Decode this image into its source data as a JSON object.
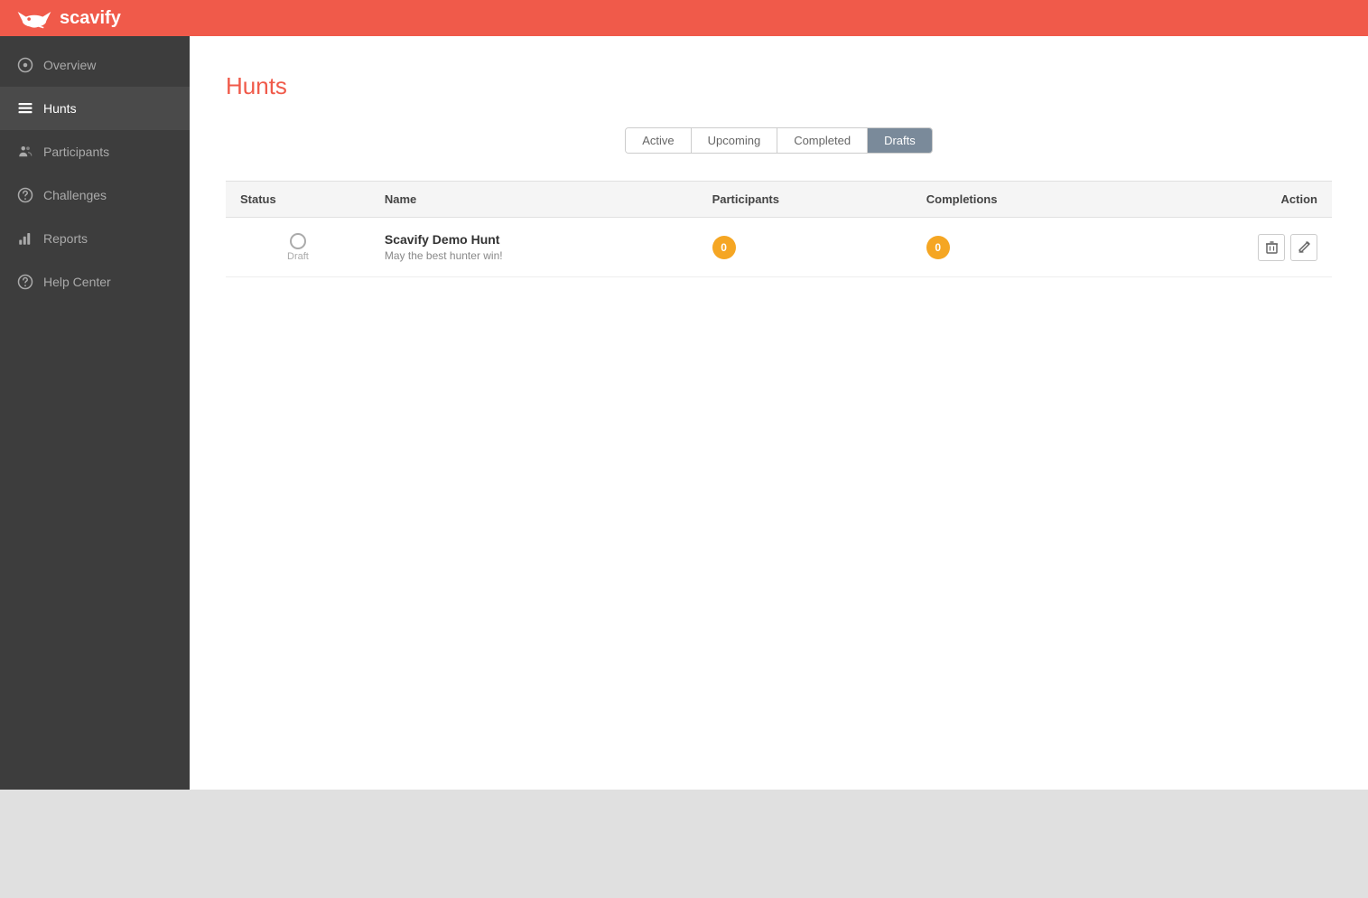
{
  "topbar": {
    "logo_text": "scavify"
  },
  "sidebar": {
    "items": [
      {
        "id": "overview",
        "label": "Overview",
        "icon": "overview-icon",
        "active": false
      },
      {
        "id": "hunts",
        "label": "Hunts",
        "icon": "hunts-icon",
        "active": true
      },
      {
        "id": "participants",
        "label": "Participants",
        "icon": "participants-icon",
        "active": false
      },
      {
        "id": "challenges",
        "label": "Challenges",
        "icon": "challenges-icon",
        "active": false
      },
      {
        "id": "reports",
        "label": "Reports",
        "icon": "reports-icon",
        "active": false
      },
      {
        "id": "help-center",
        "label": "Help Center",
        "icon": "help-icon",
        "active": false
      }
    ]
  },
  "page": {
    "title": "Hunts"
  },
  "tabs": {
    "items": [
      {
        "id": "active",
        "label": "Active",
        "active": false
      },
      {
        "id": "upcoming",
        "label": "Upcoming",
        "active": false
      },
      {
        "id": "completed",
        "label": "Completed",
        "active": false
      },
      {
        "id": "drafts",
        "label": "Drafts",
        "active": true
      }
    ]
  },
  "table": {
    "columns": {
      "status": "Status",
      "name": "Name",
      "participants": "Participants",
      "completions": "Completions",
      "action": "Action"
    },
    "rows": [
      {
        "status_label": "Draft",
        "name": "Scavify Demo Hunt",
        "description": "May the best hunter win!",
        "participants": "0",
        "completions": "0"
      }
    ]
  },
  "actions": {
    "delete_title": "Delete",
    "edit_title": "Edit"
  }
}
